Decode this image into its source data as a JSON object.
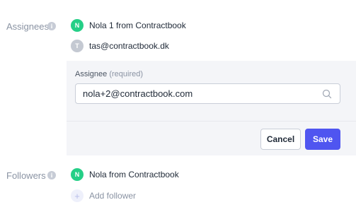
{
  "assignees": {
    "label": "Assignees",
    "info_icon": "info-icon",
    "people": [
      {
        "initial": "N",
        "name": "Nola 1 from Contractbook",
        "avatar_color": "#25cf87"
      },
      {
        "initial": "T",
        "name": "tas@contractbook.dk",
        "avatar_color": "#c4c9d2"
      }
    ]
  },
  "assignee_form": {
    "label": "Assignee",
    "required_note": "(required)",
    "input_value": "nola+2@contractbook.com",
    "search_icon": "search-icon",
    "cancel_label": "Cancel",
    "save_label": "Save",
    "save_color": "#4f55f0"
  },
  "followers": {
    "label": "Followers",
    "info_icon": "info-icon",
    "people": [
      {
        "initial": "N",
        "name": "Nola from Contractbook",
        "avatar_color": "#25cf87"
      }
    ],
    "add_icon": "plus-icon",
    "add_label": "Add follower"
  }
}
